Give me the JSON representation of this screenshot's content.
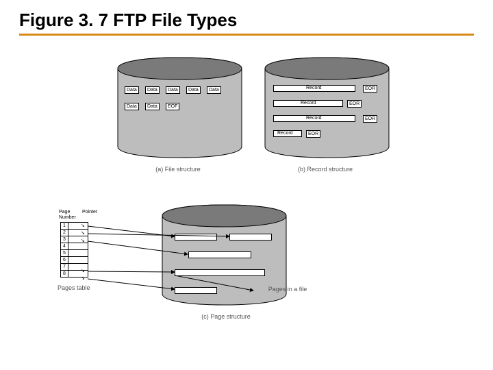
{
  "title": "Figure 3. 7 FTP File Types",
  "captions": {
    "a": "(a) File structure",
    "b": "(b) Record structure",
    "c": "(c) Page structure"
  },
  "chips": {
    "data": "Data",
    "eof": "EOF",
    "record": "Record",
    "eor": "EOR"
  },
  "pagetable": {
    "h1": "Page",
    "h2": "Number",
    "h3": "Pointer",
    "rows": [
      "1",
      "2",
      "3",
      "4",
      "5",
      "6",
      "7",
      "8"
    ],
    "label": "Pages table",
    "pages_label": "Pages in a file"
  }
}
